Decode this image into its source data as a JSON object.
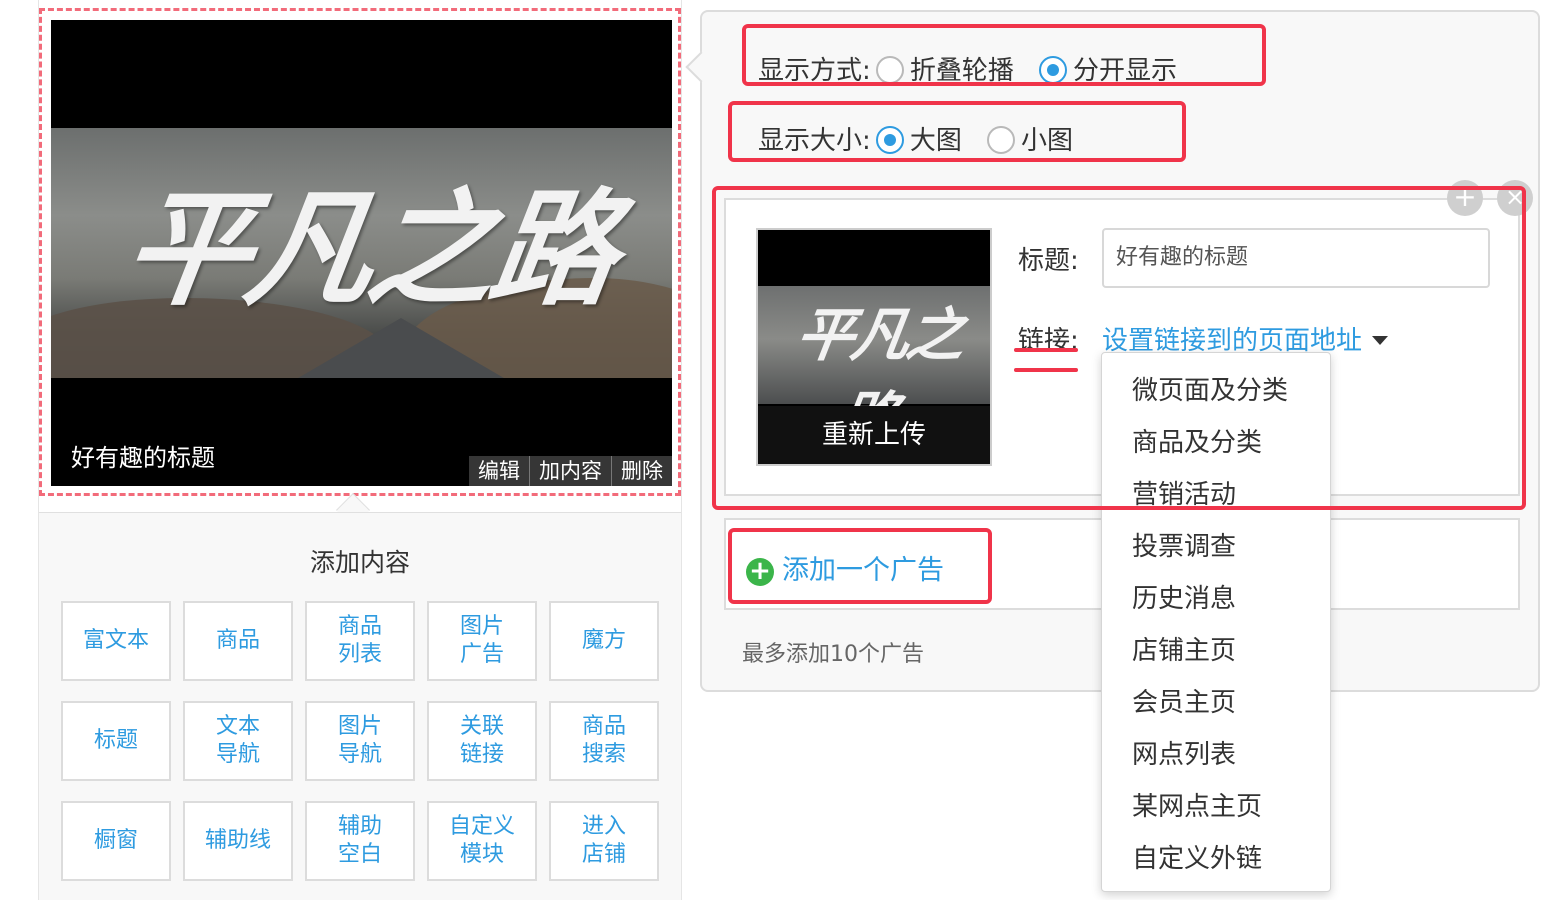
{
  "preview": {
    "calligraphy": "平凡之路",
    "title": "好有趣的标题",
    "actions": [
      "编辑",
      "加内容",
      "删除"
    ]
  },
  "add_content": {
    "heading": "添加内容",
    "items": [
      "富文本",
      "商品",
      "商品\n列表",
      "图片\n广告",
      "魔方",
      "标题",
      "文本\n导航",
      "图片\n导航",
      "关联\n链接",
      "商品\n搜索",
      "橱窗",
      "辅助线",
      "辅助\n空白",
      "自定义\n模块",
      "进入\n店铺"
    ]
  },
  "editor": {
    "display_mode": {
      "label": "显示方式:",
      "options": [
        "折叠轮播",
        "分开显示"
      ],
      "selected": "分开显示"
    },
    "display_size": {
      "label": "显示大小:",
      "options": [
        "大图",
        "小图"
      ],
      "selected": "大图"
    },
    "ad_card": {
      "thumb_calligraphy": "平凡之路",
      "reupload_label": "重新上传",
      "title_label": "标题:",
      "title_value": "好有趣的标题",
      "link_label": "链接:",
      "link_value": "设置链接到的页面地址"
    },
    "add_ad_label": "添加一个广告",
    "max_note": "最多添加10个广告"
  },
  "link_dropdown": {
    "items": [
      "微页面及分类",
      "商品及分类",
      "营销活动",
      "投票调查",
      "历史消息",
      "店铺主页",
      "会员主页",
      "网点列表",
      "某网点主页",
      "自定义外链"
    ]
  },
  "colors": {
    "accent": "#2e9be0",
    "annotation": "#f0344a",
    "add_icon": "#3bb54a",
    "preview_border": "#f26b7a"
  }
}
